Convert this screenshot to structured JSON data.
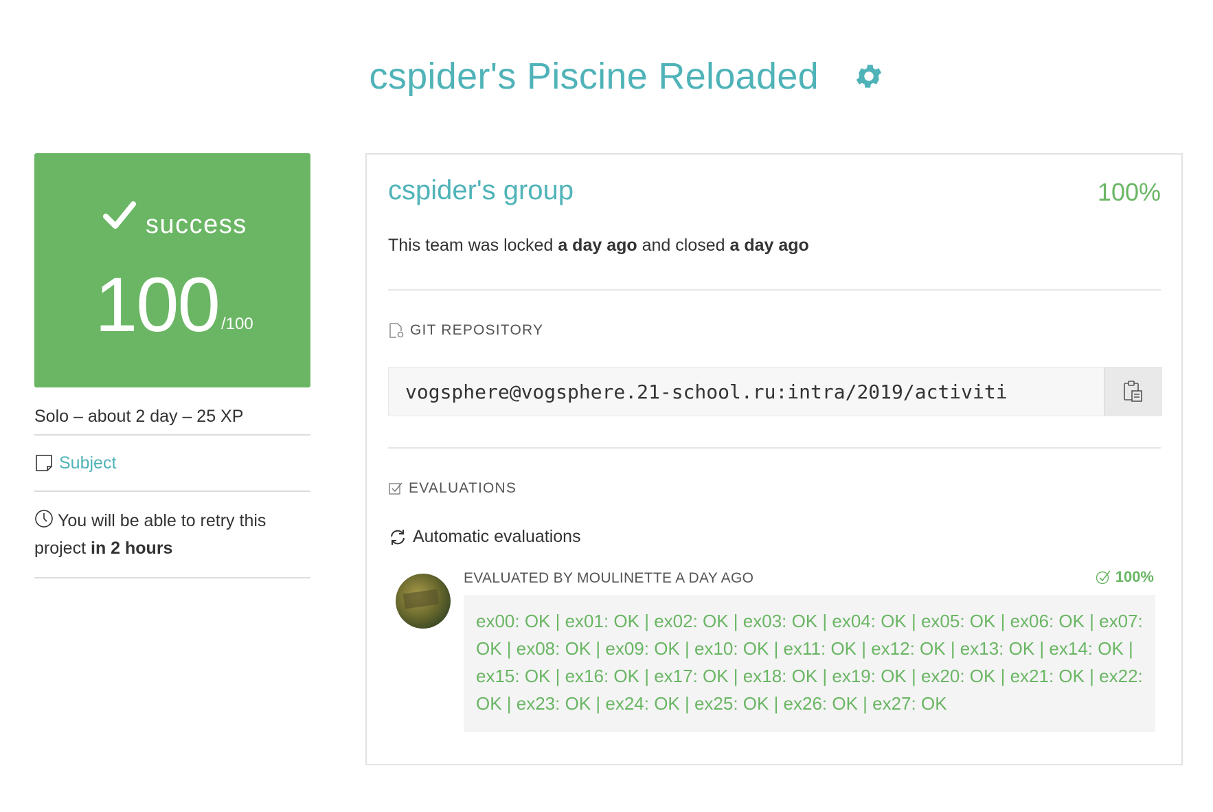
{
  "header": {
    "title": "cspider's Piscine Reloaded",
    "settings_icon": "gear-icon"
  },
  "colors": {
    "accent": "#4fb3b8",
    "success": "#6ab664"
  },
  "status": {
    "label": "success",
    "score": "100",
    "max": "/100",
    "meta": "Solo – about 2 day – 25 XP",
    "subject_link": "Subject",
    "retry_prefix": "You will be able to retry this project",
    "retry_strong": "in 2 hours"
  },
  "team": {
    "name": "cspider's group",
    "percent": "100%",
    "locked_prefix": "This team was locked",
    "locked_when": "a day ago",
    "closed_prefix": "and closed",
    "closed_when": "a day ago"
  },
  "git": {
    "label": "GIT REPOSITORY",
    "url": "vogsphere@vogsphere.21-school.ru:intra/2019/activiti"
  },
  "evaluations": {
    "label": "EVALUATIONS",
    "auto_label": "Automatic evaluations",
    "evaluated_by": "EVALUATED BY MOULINETTE A DAY AGO",
    "percent": "100%",
    "result": "ex00: OK | ex01: OK | ex02: OK | ex03: OK | ex04: OK | ex05: OK | ex06: OK | ex07: OK | ex08: OK | ex09: OK | ex10: OK | ex11: OK | ex12: OK | ex13: OK | ex14: OK | ex15: OK | ex16: OK | ex17: OK | ex18: OK | ex19: OK | ex20: OK | ex21: OK | ex22: OK | ex23: OK | ex24: OK | ex25: OK | ex26: OK | ex27: OK"
  }
}
